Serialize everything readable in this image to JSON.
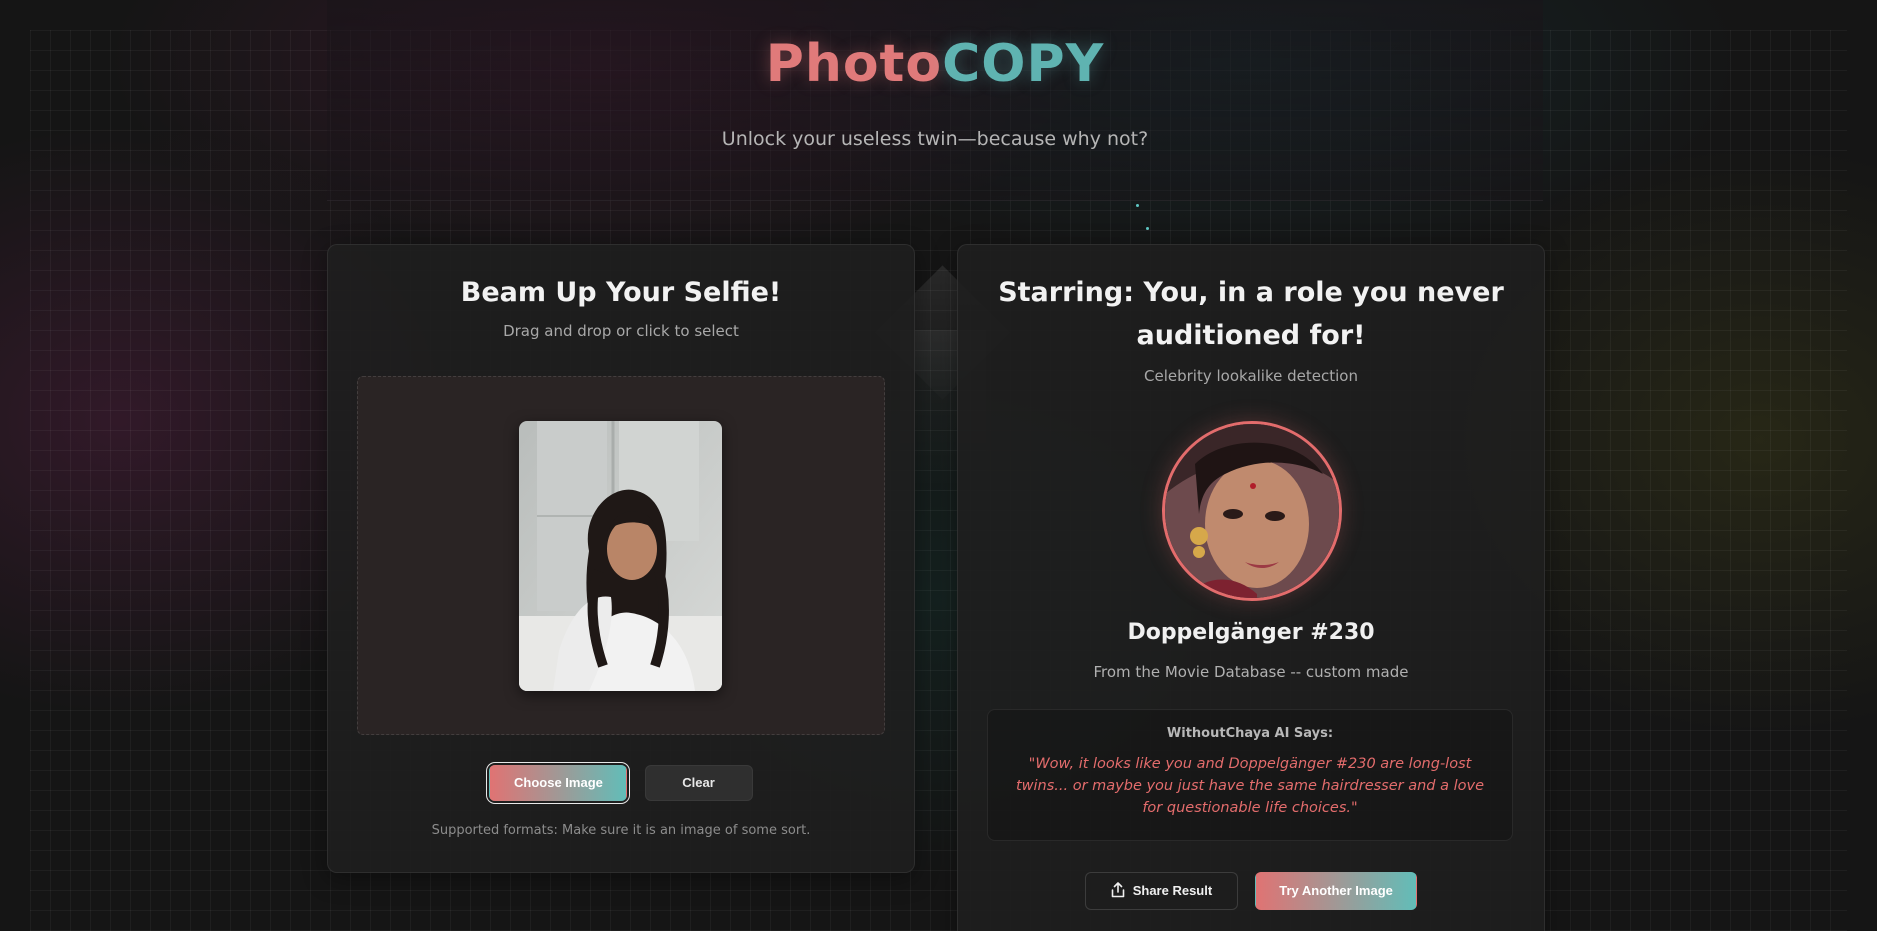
{
  "header": {
    "title_part_a": "Photo",
    "title_part_b": "COPY",
    "subtitle": "Unlock your useless twin—because why not?"
  },
  "upload_card": {
    "title": "Beam Up Your Selfie!",
    "subtitle": "Drag and drop or click to select",
    "choose_label": "Choose Image",
    "clear_label": "Clear",
    "formats_note": "Supported formats: Make sure it is an image of some sort."
  },
  "result_card": {
    "title": "Starring: You, in a role you never auditioned for!",
    "subtitle": "Celebrity lookalike detection",
    "match_name": "Doppelgänger #230",
    "match_source": "From the Movie Database -- custom made",
    "ai_heading": "WithoutChaya AI Says:",
    "ai_quote": "\"Wow, it looks like you and Doppelgänger #230 are long-lost twins... or maybe you just have the same hairdresser and a love for questionable life choices.\"",
    "share_label": "Share Result",
    "share_icon": "share-icon",
    "try_again_label": "Try Another Image"
  },
  "colors": {
    "accent_red": "#e07373",
    "accent_teal": "#62bdb8",
    "quote_red": "#e36c6c"
  }
}
